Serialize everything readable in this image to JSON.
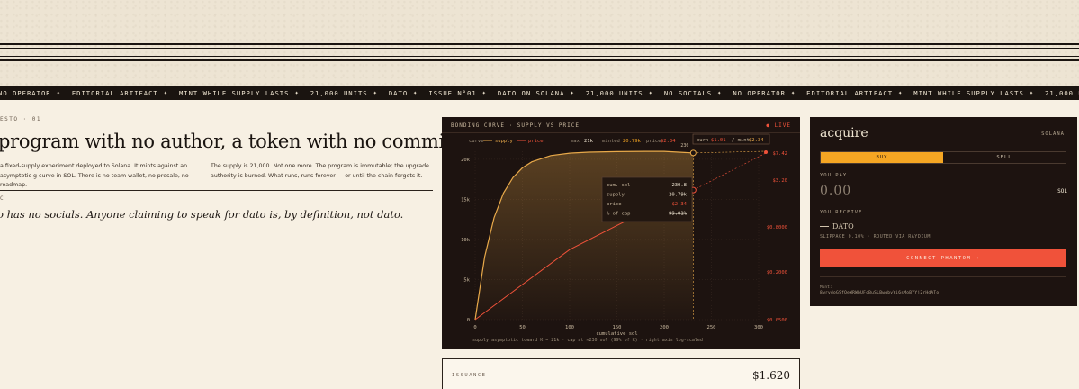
{
  "ticker": [
    "NO OPERATOR",
    "EDITORIAL ARTIFACT",
    "MINT WHILE SUPPLY LASTS",
    "21,000 UNITS",
    "DATO",
    "ISSUE N°01",
    "DATO ON SOLANA",
    "21,000 UNITS",
    "NO SOCIALS",
    "NO OPERATOR",
    "EDITORIAL ARTIFACT",
    "MINT WHILE SUPPLY LASTS",
    "21,000 UNITS"
  ],
  "manifesto": {
    "kicker": "ESTO · 01",
    "headline": "program with no author, a token with no committee.",
    "para1": "a fixed-supply experiment deployed to Solana. It mints against an asymptotic g curve in SOL. There is no team wallet, no presale, no roadmap.",
    "para2": "The supply is 21,000. Not one more. The program is immutable; the upgrade authority is burned. What runs, runs forever — or until the chain forgets it.",
    "mark": "C",
    "tagline": "o has no socials. Anyone claiming to speak for dato is, by definition, not dato."
  },
  "chart_panel": {
    "title": "BONDING CURVE · SUPPLY VS PRICE",
    "live": "● LIVE",
    "legend": {
      "prefix": "curve",
      "supply_label": "supply",
      "price_label": "price",
      "max_label": "max",
      "max_value": "21k",
      "minted_label": "minted",
      "minted_value": "20.79k",
      "price_stat_label": "price",
      "price_stat_value": "$2.34"
    },
    "burn_box": {
      "burn_label": "burn",
      "burn_value": "$1.01",
      "mint_label": "/ mint",
      "mint_value": "$2.34"
    },
    "cursor_label": "230",
    "tooltip": {
      "rows": [
        {
          "label": "cum. sol",
          "value": "230.8"
        },
        {
          "label": "supply",
          "value": "20.79k"
        },
        {
          "label": "price",
          "value": "$2.34"
        },
        {
          "label": "% of cap",
          "value": "99.01%"
        }
      ]
    },
    "footnote": "supply asymptotic toward K = 21k · cap at ≈230 sol (99% of K) · right axis log-scaled"
  },
  "chart_data": {
    "type": "line",
    "title": "BONDING CURVE · SUPPLY VS PRICE",
    "xlabel": "cumulative sol",
    "ylabel": "",
    "xlim": [
      0,
      300
    ],
    "ylim": [
      0,
      21000
    ],
    "x_ticks": [
      "0",
      "50",
      "100",
      "150",
      "200",
      "250",
      "300"
    ],
    "y_ticks_left": [
      "0",
      "5k",
      "10k",
      "15k",
      "20k"
    ],
    "y_ticks_right": [
      "$0.0500",
      "$0.2000",
      "$0.8000",
      "$3.20",
      "$7.42"
    ],
    "y2lim": [
      0.05,
      7.42
    ],
    "y2_scale": "log",
    "grid": true,
    "series": [
      {
        "name": "supply",
        "axis": "left",
        "color": "#e8a94a",
        "x": [
          0,
          10,
          20,
          30,
          40,
          50,
          60,
          80,
          100,
          120,
          150,
          180,
          200,
          230.8
        ],
        "y": [
          0,
          7810,
          12710,
          15790,
          17720,
          18930,
          19690,
          20460,
          20760,
          20890,
          20960,
          20985,
          20993,
          20790
        ]
      },
      {
        "name": "price",
        "axis": "right",
        "color": "#f0523a",
        "x": [
          0,
          50,
          100,
          150,
          200,
          230.8
        ],
        "y": [
          0.05,
          0.142,
          0.4,
          0.82,
          1.66,
          2.34
        ]
      }
    ],
    "markers": [
      {
        "series": "supply",
        "x": 230.8,
        "y": 20790
      },
      {
        "series": "price",
        "x": 230.8,
        "y": 2.34
      }
    ]
  },
  "acquire": {
    "title": "acquire",
    "chain": "SOLANA",
    "tab_buy": "BUY",
    "tab_sell": "SELL",
    "pay_label": "YOU PAY",
    "pay_value": "0.00",
    "pay_unit": "SOL",
    "receive_label": "YOU RECEIVE",
    "receive_value": "DATO",
    "slippage": "SLIPPAGE 0.10% · ROUTED VIA RAYDIUM",
    "connect": "CONNECT PHANTOM →",
    "mint_label": "Mint:",
    "mint_address": "8wrvdoGSfQeWRWbUFcBuSLBwqbyYi6sMoBYYj2rHdATo"
  },
  "issuance": {
    "label": "ISSUANCE",
    "value": "$1.620"
  },
  "colors": {
    "panel": "#1d1310",
    "paper": "#f7f0e3",
    "amber": "#f5a623",
    "vermilion": "#f0523a"
  }
}
